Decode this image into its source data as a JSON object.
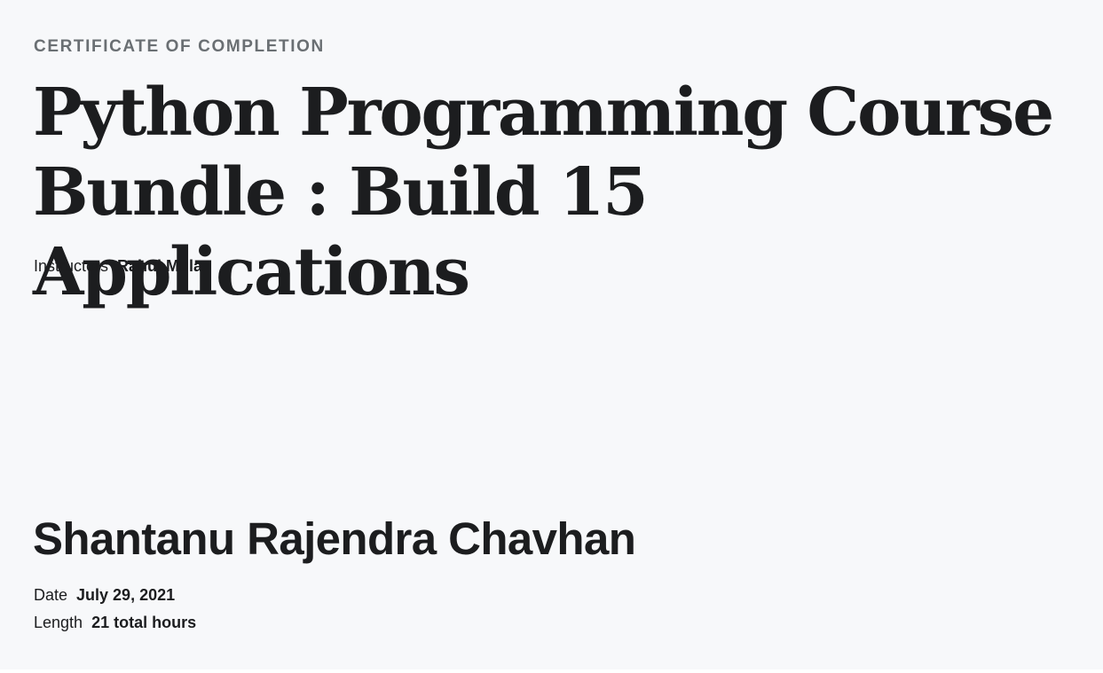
{
  "certificate": {
    "eyebrow": "CERTIFICATE OF COMPLETION",
    "course_title": "Python Programming Course Bundle : Build 15 Applications",
    "instructors": {
      "label": "Instructors",
      "value": "Rahul Mula"
    },
    "recipient_name": "Shantanu Rajendra Chavhan",
    "date": {
      "label": "Date",
      "value": "July 29, 2021"
    },
    "length": {
      "label": "Length",
      "value": "21 total hours"
    }
  },
  "colors": {
    "background": "#f7f8fa",
    "text_primary": "#1c1d1f",
    "text_muted": "#6a6f73"
  }
}
